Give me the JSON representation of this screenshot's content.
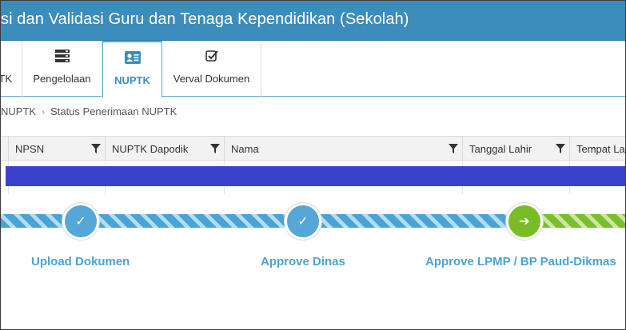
{
  "header": {
    "title": "si dan Validasi Guru dan Tenaga Kependidikan (Sekolah)"
  },
  "tabs": [
    {
      "label": "TK",
      "icon": "unknown-icon",
      "active": false
    },
    {
      "label": "Pengelolaan",
      "icon": "server-icon",
      "active": false
    },
    {
      "label": "NUPTK",
      "icon": "id-card-icon",
      "active": true
    },
    {
      "label": "Verval Dokumen",
      "icon": "checkbox-icon",
      "active": false
    }
  ],
  "breadcrumb": {
    "items": [
      "NUPTK",
      "Status Penerimaan NUPTK"
    ]
  },
  "table": {
    "columns": [
      "NPSN",
      "NUPTK Dapodik",
      "Nama",
      "Tanggal Lahir",
      "Tempat Lahir"
    ],
    "selected_row_color": "#3a42cc"
  },
  "stepper": {
    "steps": [
      {
        "label": "Upload Dokumen",
        "status": "done",
        "icon": "check-icon",
        "glyph": "✓"
      },
      {
        "label": "Approve Dinas",
        "status": "done",
        "icon": "check-icon",
        "glyph": "✓"
      },
      {
        "label": "Approve LPMP / BP Paud-Dikmas",
        "status": "current",
        "icon": "arrow-right-icon",
        "glyph": "➔"
      }
    ],
    "colors": {
      "done": "#4aa3d6",
      "current": "#79bd26"
    }
  },
  "colors": {
    "header_bg": "#3c8dbc",
    "accent": "#3c8dbc"
  }
}
